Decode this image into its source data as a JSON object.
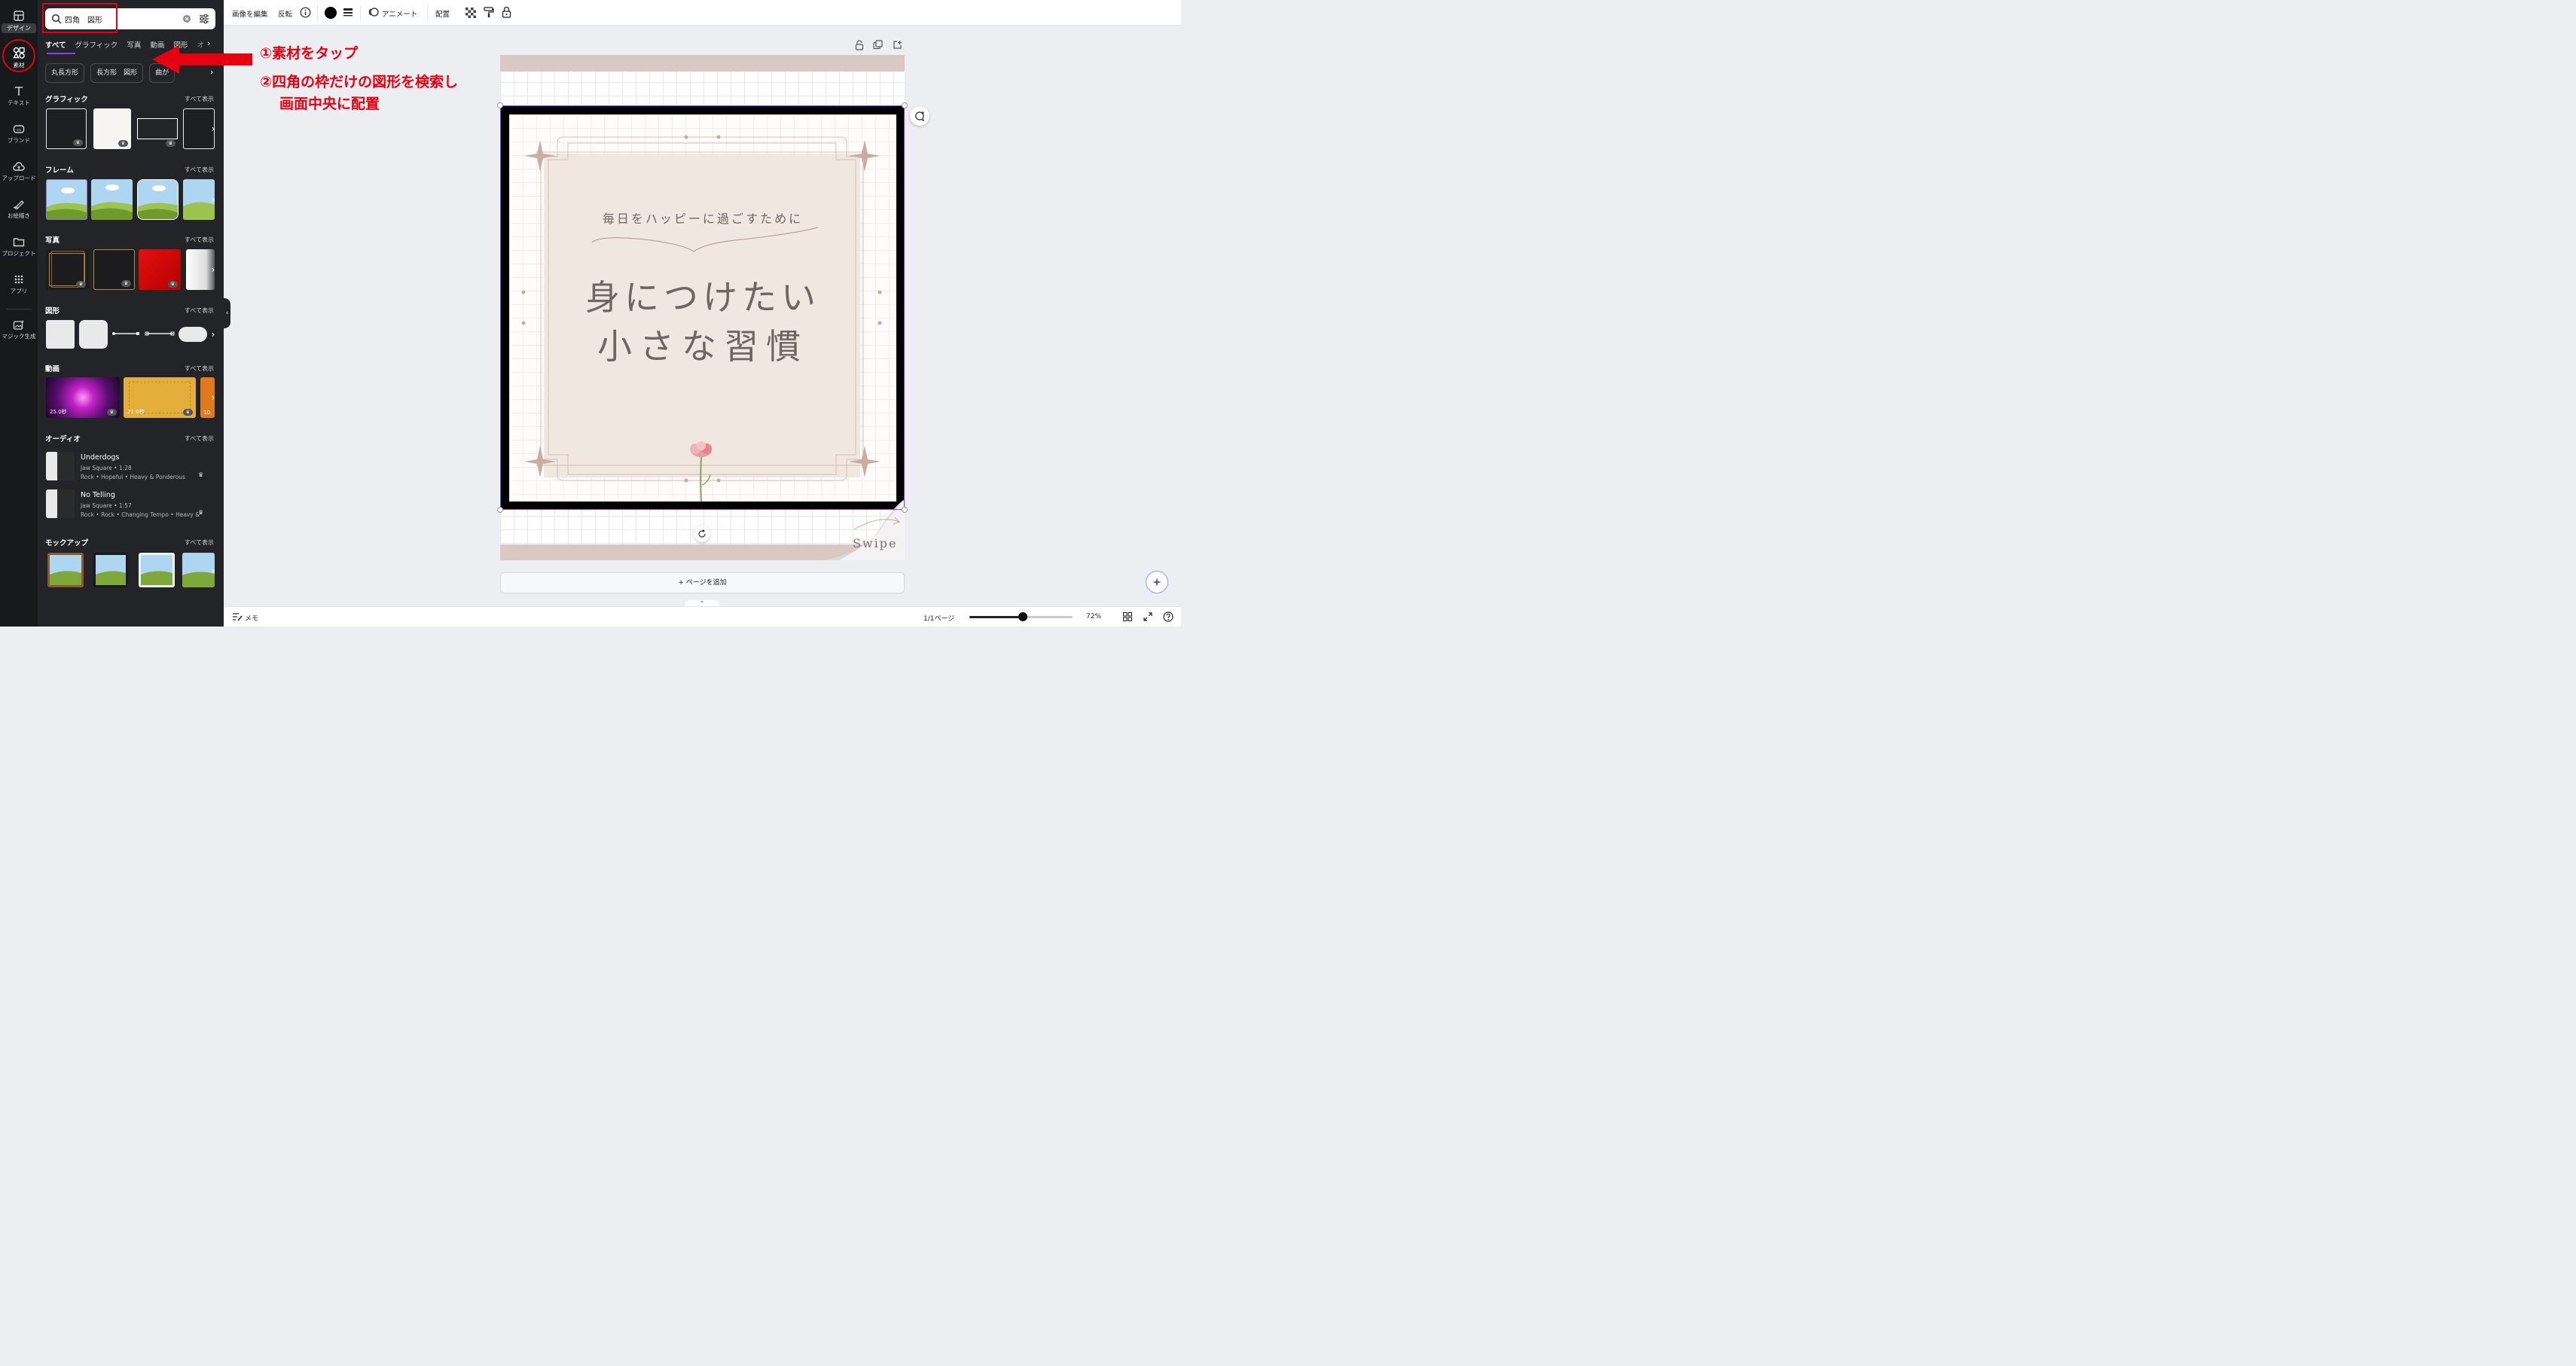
{
  "rail": {
    "design": "デザイン",
    "elements": "素材",
    "text": "テキスト",
    "brand": "ブランド",
    "upload": "アップロード",
    "draw": "お絵描き",
    "projects": "プロジェクト",
    "apps": "アプリ",
    "magic": "マジック生成"
  },
  "panel": {
    "search_value": "四角　図形",
    "tabs": [
      "すべて",
      "グラフィック",
      "写真",
      "動画",
      "図形",
      "オ"
    ],
    "chips": [
      "丸長方形",
      "長方形　図形",
      "曲が"
    ],
    "see_all": "すべて表示",
    "sections": {
      "graphics": "グラフィック",
      "frames": "フレーム",
      "photos": "写真",
      "shapes": "図形",
      "videos": "動画",
      "audio": "オーディオ",
      "mockups": "モックアップ"
    },
    "videos": [
      "25.0秒",
      "21.0秒",
      "10."
    ],
    "audio": [
      {
        "title": "Underdogs",
        "meta": "Jaw Square • 1:28",
        "tags": "Rock • Hopeful • Heavy & Ponderous"
      },
      {
        "title": "No Telling",
        "meta": "Jaw Square • 1:57",
        "tags": "Rock • Rock • Changing Tempo • Heavy &"
      }
    ]
  },
  "toolbar": {
    "edit_image": "画像を編集",
    "flip": "反転",
    "animate": "アニメート",
    "position": "配置",
    "fill_color": "#000000"
  },
  "canvas": {
    "subtitle": "毎日をハッピーに過ごすために",
    "title_line1": "身につけたい",
    "title_line2": "小さな習慣",
    "swipe": "Swipe",
    "add_page": "+ ページを追加"
  },
  "bottombar": {
    "notes": "メモ",
    "page_count": "1/1ページ",
    "zoom": "72%",
    "zoom_fraction": 0.52
  },
  "annotations": {
    "step1": "①素材をタップ",
    "step2_line1": "②四角の枠だけの図形を検索し",
    "step2_line2": "画面中央に配置"
  },
  "colors": {
    "accent_red": "#e60012",
    "selection": "#8b3dff",
    "card_beige": "#f0e7e1",
    "band": "#d9c8c3",
    "title_text": "#6f6663"
  }
}
